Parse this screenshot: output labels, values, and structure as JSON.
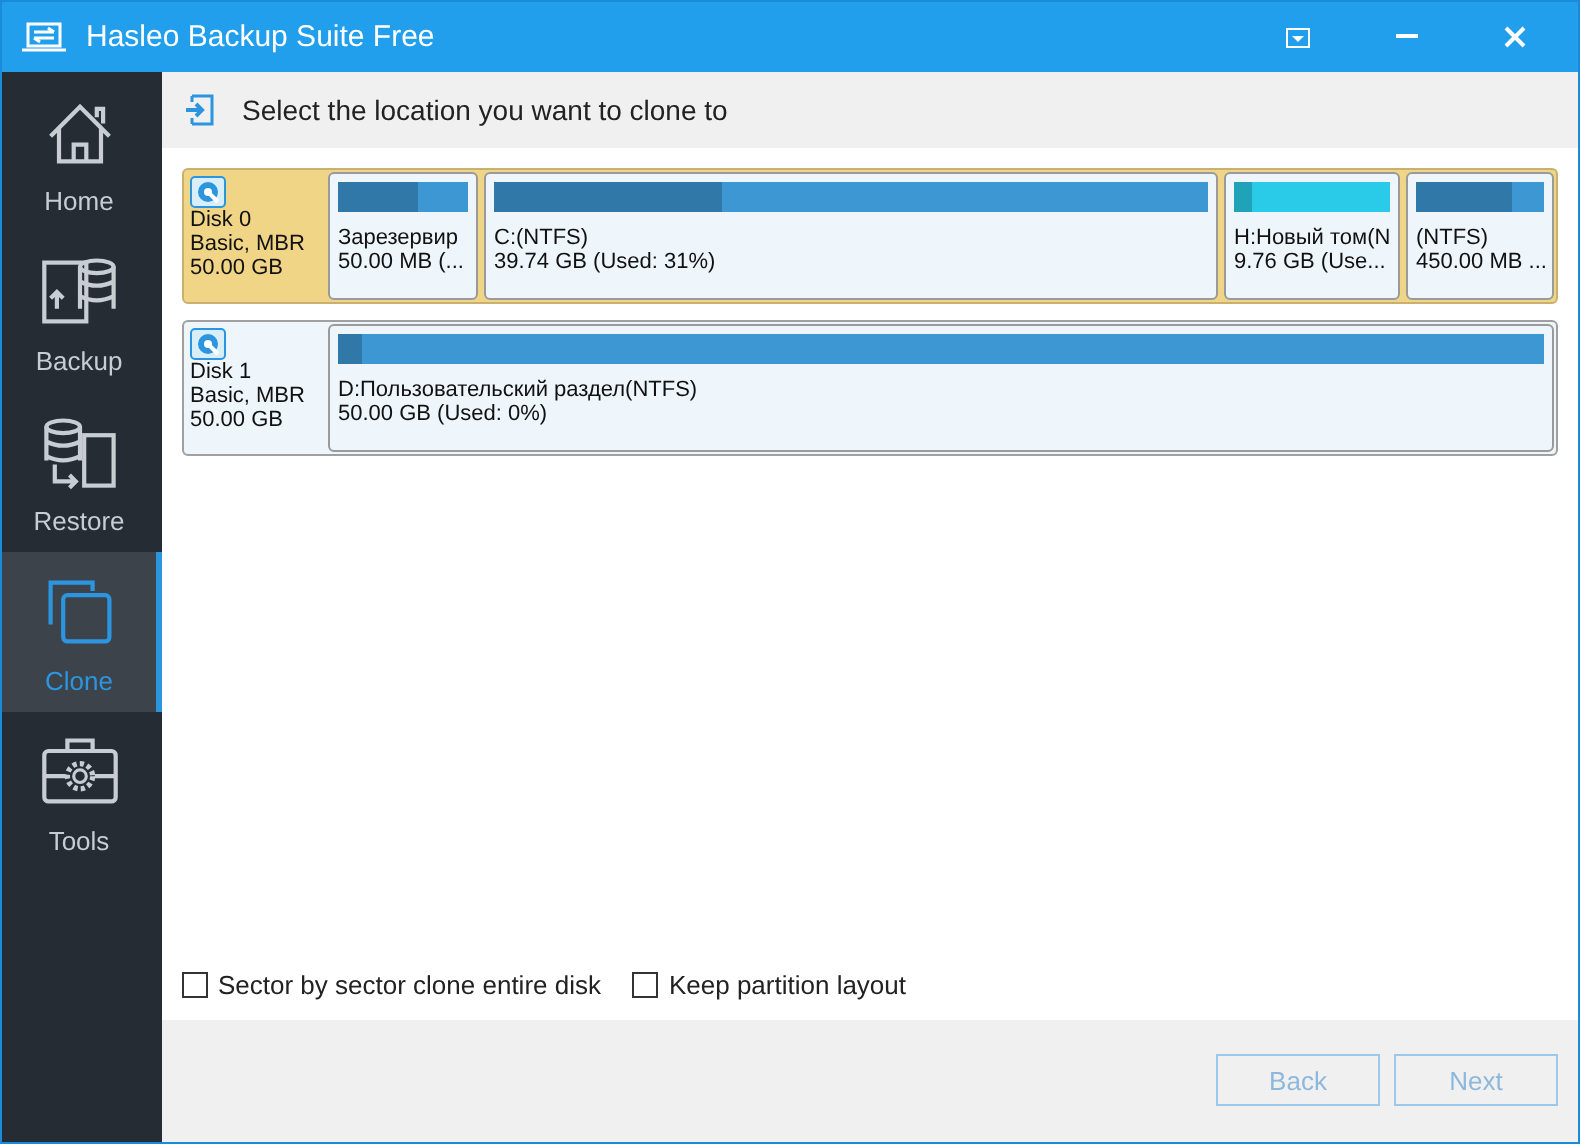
{
  "window": {
    "title": "Hasleo Backup Suite Free"
  },
  "sidebar": {
    "items": [
      {
        "label": "Home",
        "selected": false
      },
      {
        "label": "Backup",
        "selected": false
      },
      {
        "label": "Restore",
        "selected": false
      },
      {
        "label": "Clone",
        "selected": true
      },
      {
        "label": "Tools",
        "selected": false
      }
    ]
  },
  "header": {
    "text": "Select the location you want to clone to"
  },
  "disks": [
    {
      "name": "Disk 0",
      "type": "Basic, MBR",
      "size": "50.00 GB",
      "selected": true,
      "partitions": [
        {
          "label": "Зарезервир",
          "detail": "50.00 MB (...",
          "level": 0.62,
          "color": "#3d97d3"
        },
        {
          "label": "C:(NTFS)",
          "detail": "39.74 GB (Used: 31%)",
          "level": 0.32,
          "color": "#3d97d3"
        },
        {
          "label": "H:Новый том(N",
          "detail": "9.76 GB (Use...",
          "level": 0.12,
          "color": "#29cbe8"
        },
        {
          "label": "(NTFS)",
          "detail": "450.00 MB ...",
          "level": 0.75,
          "color": "#3d97d3"
        }
      ]
    },
    {
      "name": "Disk 1",
      "type": "Basic, MBR",
      "size": "50.00 GB",
      "selected": false,
      "partitions": [
        {
          "label": "D:Пользовательский раздел(NTFS)",
          "detail": "50.00 GB (Used: 0%)",
          "level": 0.02,
          "color": "#3d97d3"
        }
      ]
    }
  ],
  "options": [
    {
      "label": "Sector by sector clone entire disk",
      "checked": false
    },
    {
      "label": "Keep partition layout",
      "checked": false
    }
  ],
  "buttons": [
    {
      "label": "Back",
      "disabled": true
    },
    {
      "label": "Next",
      "disabled": true
    }
  ]
}
